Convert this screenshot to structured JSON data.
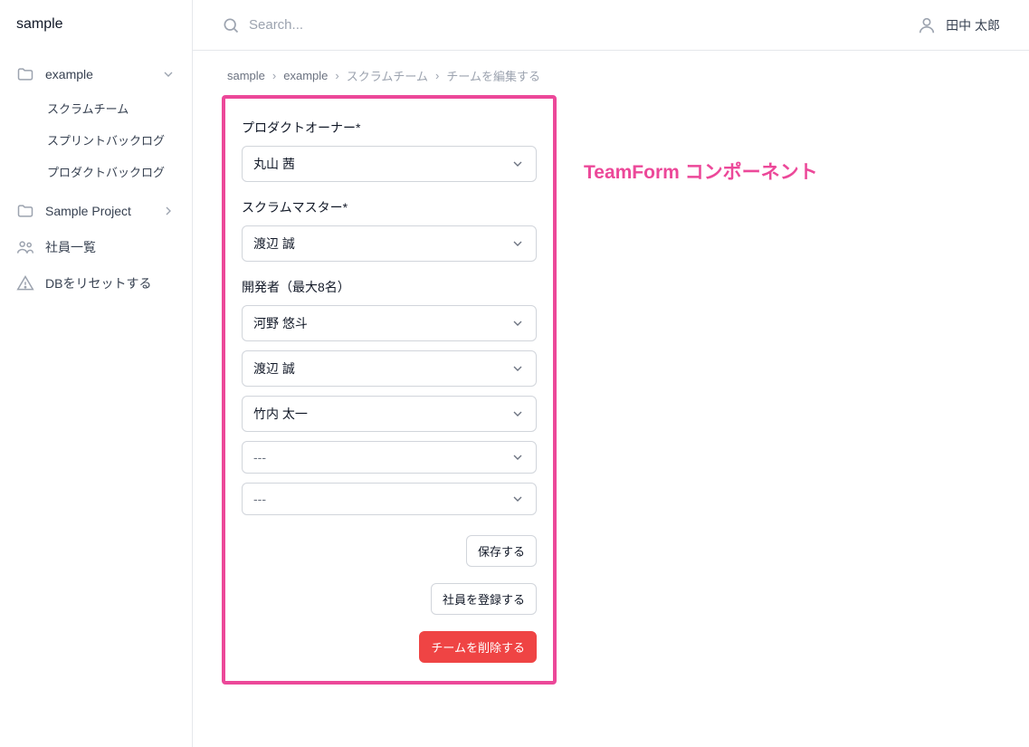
{
  "brand": "sample",
  "sidebar": {
    "items": [
      {
        "label": "example",
        "type": "folder",
        "expanded": true
      },
      {
        "label": "Sample Project",
        "type": "folder",
        "expanded": false
      },
      {
        "label": "社員一覧",
        "type": "users"
      },
      {
        "label": "DBをリセットする",
        "type": "warning"
      }
    ],
    "example_children": [
      {
        "label": "スクラムチーム"
      },
      {
        "label": "スプリントバックログ"
      },
      {
        "label": "プロダクトバックログ"
      }
    ]
  },
  "search": {
    "placeholder": "Search..."
  },
  "user": {
    "name": "田中 太郎"
  },
  "breadcrumb": [
    "sample",
    "example",
    "スクラムチーム",
    "チームを編集する"
  ],
  "form": {
    "product_owner_label": "プロダクトオーナー*",
    "product_owner_value": "丸山 茜",
    "scrum_master_label": "スクラムマスター*",
    "scrum_master_value": "渡辺 誠",
    "developers_label": "開発者（最大8名）",
    "developers": [
      "河野 悠斗",
      "渡辺 誠",
      "竹内 太一",
      "---",
      "---"
    ],
    "save_label": "保存する",
    "register_label": "社員を登録する",
    "delete_label": "チームを削除する"
  },
  "annotation": "TeamForm コンポーネント"
}
